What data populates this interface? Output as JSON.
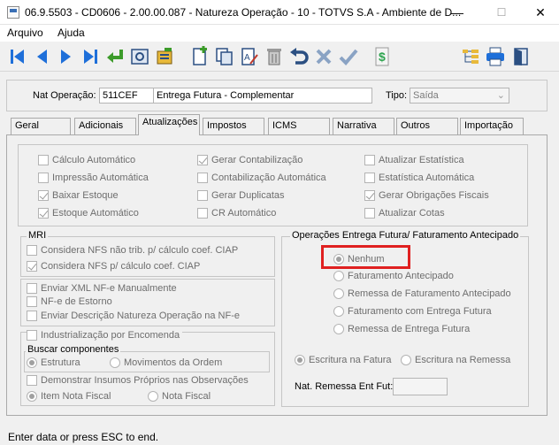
{
  "window": {
    "title": "06.9.5503 - CD0606 - 2.00.00.087 - Natureza Operação - 10 - TOTVS S.A - Ambiente de D...",
    "minimize": "—",
    "maximize": "☐",
    "close": "✕"
  },
  "menu": {
    "items": [
      "Arquivo",
      "Ajuda"
    ]
  },
  "toolbar": {
    "icons": [
      "first-record-icon",
      "previous-record-icon",
      "next-record-icon",
      "last-record-icon",
      "return-icon",
      "preview-icon",
      "report-icon",
      "new-record-icon",
      "copy-record-icon",
      "edit-record-icon",
      "delete-record-icon",
      "undo-icon",
      "cancel-icon",
      "confirm-icon",
      "currency-icon",
      "tree-icon",
      "print-icon",
      "exit-icon"
    ]
  },
  "header": {
    "nat_label": "Nat Operação:",
    "nat_code": "511CEF",
    "nat_desc": "Entrega Futura - Complementar",
    "tipo_label": "Tipo:",
    "tipo_value": "Saída"
  },
  "tabs": [
    "Geral",
    "Adicionais",
    "Atualizações",
    "Impostos",
    "ICMS",
    "Narrativa",
    "Outros",
    "Importação"
  ],
  "active_tab": "Atualizações",
  "updates": {
    "col1": [
      {
        "label": "Cálculo Automático",
        "checked": false
      },
      {
        "label": "Impressão Automática",
        "checked": false
      },
      {
        "label": "Baixar Estoque",
        "checked": true
      },
      {
        "label": "Estoque Automático",
        "checked": true
      }
    ],
    "col2": [
      {
        "label": "Gerar Contabilização",
        "checked": true
      },
      {
        "label": "Contabilização Automática",
        "checked": false
      },
      {
        "label": "Gerar Duplicatas",
        "checked": false
      },
      {
        "label": "CR Automático",
        "checked": false
      }
    ],
    "col3": [
      {
        "label": "Atualizar Estatística",
        "checked": false
      },
      {
        "label": "Estatística Automática",
        "checked": false
      },
      {
        "label": "Gerar Obrigações Fiscais",
        "checked": true
      },
      {
        "label": "Atualizar Cotas",
        "checked": false
      }
    ]
  },
  "mri": {
    "legend": "MRI",
    "opt1": "Considera NFS não trib. p/ cálculo coef. CIAP",
    "opt2": "Considera NFS p/ cálculo coef. CIAP"
  },
  "nfe": {
    "opt1": "Enviar XML NF-e Manualmente",
    "opt2": "NF-e de Estorno",
    "opt3": "Enviar Descrição Natureza Operação na NF-e"
  },
  "industrial": {
    "label": "Industrialização por Encomenda",
    "buscar_legend": "Buscar componentes",
    "estrutura": "Estrutura",
    "movimentos": "Movimentos da Ordem",
    "demonstrar": "Demonstrar Insumos Próprios nas Observações",
    "item_nota": "Item Nota Fiscal",
    "nota_fiscal": "Nota Fiscal"
  },
  "entrega_futura": {
    "legend": "Operações Entrega Futura/ Faturamento Antecipado",
    "options": [
      "Nenhum",
      "Faturamento Antecipado",
      "Remessa de Faturamento Antecipado",
      "Faturamento com Entrega Futura",
      "Remessa de Entrega Futura"
    ],
    "selected": "Nenhum",
    "escritura_fatura": "Escritura na Fatura",
    "escritura_remessa": "Escritura na Remessa",
    "nat_remessa_label": "Nat. Remessa Ent Fut:",
    "nat_remessa_value": ""
  },
  "status": "Enter data or press ESC to end.",
  "colors": {
    "toolbar_blue": "#1e6fd9",
    "highlight_red": "#e02020",
    "accent_green": "#2ea44f"
  }
}
